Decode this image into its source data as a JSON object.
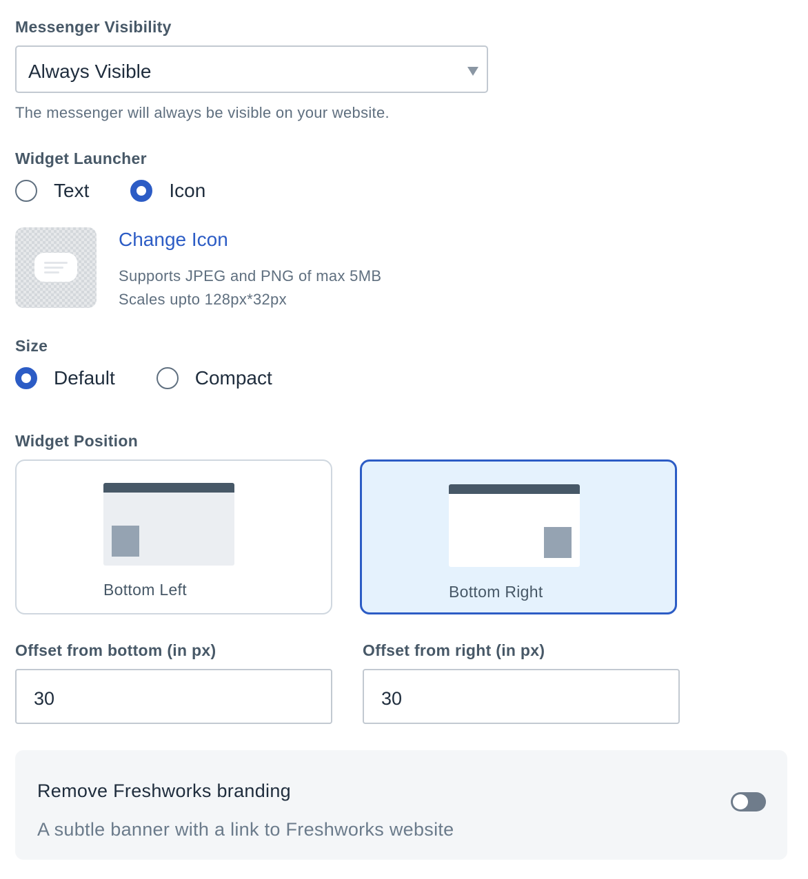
{
  "visibility": {
    "label": "Messenger Visibility",
    "selected": "Always Visible",
    "help": "The messenger will always be visible on your website."
  },
  "launcher": {
    "label": "Widget Launcher",
    "options": [
      {
        "label": "Text",
        "selected": false
      },
      {
        "label": "Icon",
        "selected": true
      }
    ],
    "change_icon": "Change Icon",
    "support_line1": "Supports JPEG and PNG of max 5MB",
    "support_line2": "Scales upto 128px*32px"
  },
  "size": {
    "label": "Size",
    "options": [
      {
        "label": "Default",
        "selected": true
      },
      {
        "label": "Compact",
        "selected": false
      }
    ]
  },
  "position": {
    "label": "Widget Position",
    "options": [
      {
        "label": "Bottom Left",
        "selected": false
      },
      {
        "label": "Bottom Right",
        "selected": true
      }
    ]
  },
  "offsets": {
    "bottom_label": "Offset from bottom (in px)",
    "bottom_value": "30",
    "right_label": "Offset from right (in px)",
    "right_value": "30"
  },
  "branding": {
    "title": "Remove Freshworks branding",
    "subtitle": "A subtle banner with a link to Freshworks website",
    "enabled": false
  },
  "colors": {
    "accent": "#2c5cc5",
    "selected_card_bg": "#e5f2fd",
    "toggle_off": "#6f7c8b"
  }
}
